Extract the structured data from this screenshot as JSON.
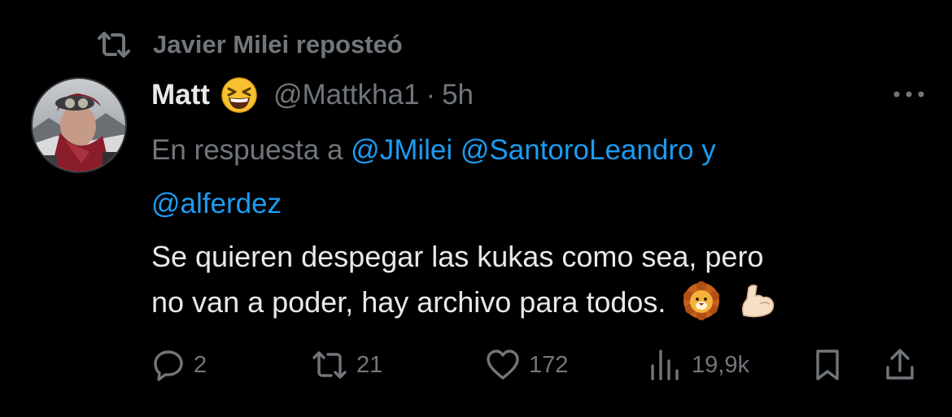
{
  "repost": {
    "text": "Javier Milei reposteó",
    "icon": "repost-icon"
  },
  "tweet": {
    "author": {
      "display_name": "Matt",
      "emoji": "grinning-squinting-face-emoji",
      "handle": "@Mattkha1",
      "separator": "·",
      "time": "5h"
    },
    "reply_to": {
      "prefix": "En respuesta a",
      "mentions": [
        "@JMilei",
        "@SantoroLeandro",
        "@alferdez"
      ],
      "joiner": "y"
    },
    "text_line1": "Se quieren despegar las kukas como sea, pero",
    "text_line2": "no van a poder, hay archivo para todos.",
    "text_emojis": [
      "lion-face-emoji",
      "flexed-biceps-emoji"
    ]
  },
  "actions": {
    "replies": "2",
    "reposts": "21",
    "likes": "172",
    "views": "19,9k"
  },
  "colors": {
    "background": "#000000",
    "primary_text": "#e7e9ea",
    "secondary_text": "#71767b",
    "link": "#1d9bf0"
  }
}
